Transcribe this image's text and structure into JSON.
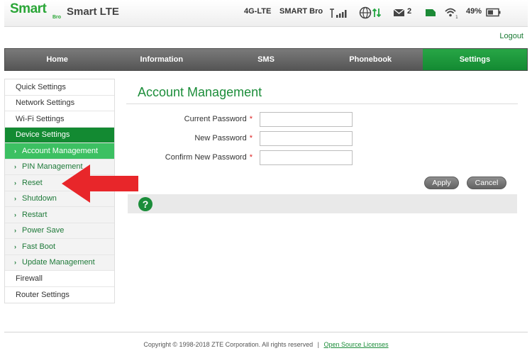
{
  "header": {
    "logo_text": "Smart",
    "logo_sub": "Bro",
    "product_name": "Smart LTE",
    "network_type": "4G-LTE",
    "carrier": "SMART Bro",
    "sms_count": "2",
    "battery": "49%"
  },
  "logout_label": "Logout",
  "nav": {
    "tabs": [
      {
        "label": "Home"
      },
      {
        "label": "Information"
      },
      {
        "label": "SMS"
      },
      {
        "label": "Phonebook"
      },
      {
        "label": "Settings"
      }
    ],
    "active": "Settings"
  },
  "sidebar": {
    "items": [
      {
        "label": "Quick Settings"
      },
      {
        "label": "Network Settings"
      },
      {
        "label": "Wi-Fi Settings"
      },
      {
        "label": "Device Settings"
      }
    ],
    "sub_items": [
      {
        "label": "Account Management"
      },
      {
        "label": "PIN Management"
      },
      {
        "label": "Reset"
      },
      {
        "label": "Shutdown"
      },
      {
        "label": "Restart"
      },
      {
        "label": "Power Save"
      },
      {
        "label": "Fast Boot"
      },
      {
        "label": "Update Management"
      }
    ],
    "bottom_items": [
      {
        "label": "Firewall"
      },
      {
        "label": "Router Settings"
      }
    ],
    "chevron": "›"
  },
  "content": {
    "title": "Account Management",
    "fields": [
      {
        "label": "Current Password",
        "value": "",
        "required_mark": "*"
      },
      {
        "label": "New Password",
        "value": "",
        "required_mark": "*"
      },
      {
        "label": "Confirm New Password",
        "value": "",
        "required_mark": "*"
      }
    ],
    "apply_label": "Apply",
    "cancel_label": "Cancel",
    "help_icon": "?"
  },
  "footer": {
    "copyright": "Copyright © 1998-2018 ZTE Corporation. All rights reserved",
    "separator": "|",
    "link_label": "Open Source Licenses"
  },
  "colors": {
    "brand_green": "#138a32",
    "active_sub": "#3cc062",
    "annotation_arrow": "#e8262a"
  }
}
